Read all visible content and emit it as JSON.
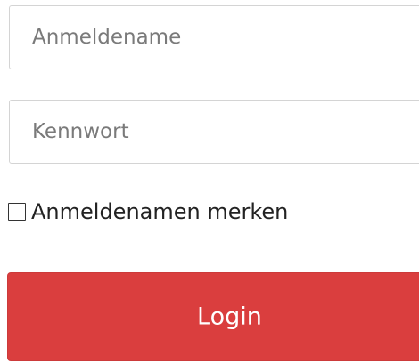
{
  "login_form": {
    "username": {
      "value": "",
      "placeholder": "Anmeldename"
    },
    "password": {
      "value": "",
      "placeholder": "Kennwort"
    },
    "remember": {
      "label": "Anmeldenamen merken",
      "checked": false
    },
    "submit_label": "Login"
  },
  "colors": {
    "button_background": "#da3e3e",
    "button_text": "#ffffff",
    "field_border": "#d4d4d4",
    "placeholder_text": "#7a7a7a"
  }
}
